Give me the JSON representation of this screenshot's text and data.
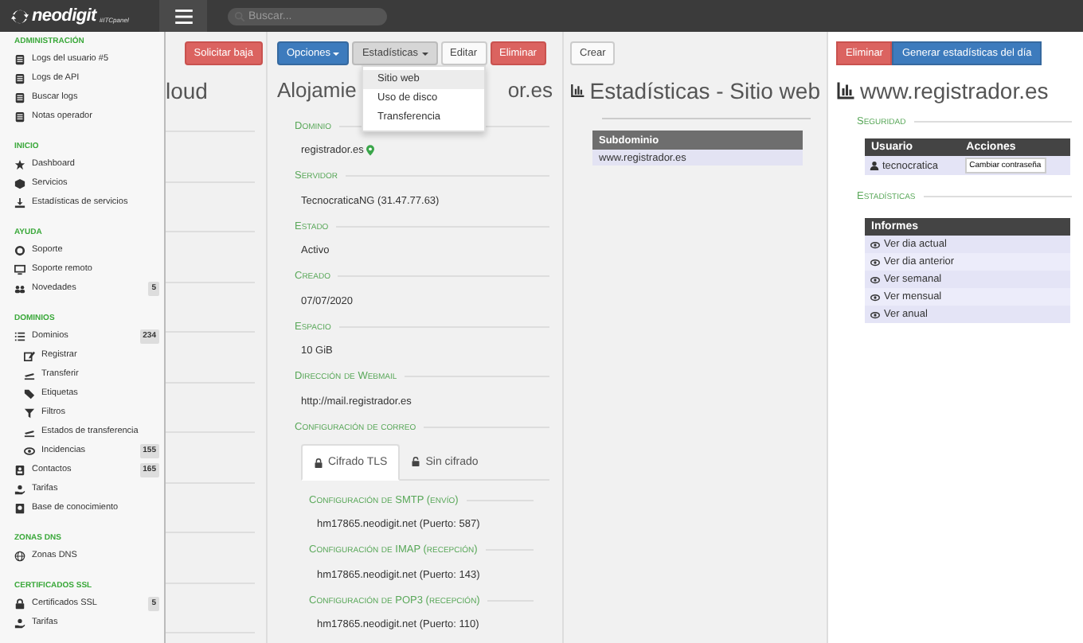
{
  "topbar": {
    "logo": "neodigit",
    "logo_tag": "#ITCpanel",
    "search": {
      "placeholder": "Buscar..."
    }
  },
  "sidebar": {
    "sections": [
      {
        "heading": "ADMINISTRACIÓN",
        "items": [
          {
            "label": "Logs del usuario #5"
          },
          {
            "label": "Logs de API"
          },
          {
            "label": "Buscar logs"
          },
          {
            "label": "Notas operador"
          }
        ]
      },
      {
        "heading": "INICIO",
        "items": [
          {
            "label": "Dashboard"
          },
          {
            "label": "Servicios"
          },
          {
            "label": "Estadísticas de servicios"
          }
        ]
      },
      {
        "heading": "AYUDA",
        "items": [
          {
            "label": "Soporte"
          },
          {
            "label": "Soporte remoto"
          },
          {
            "label": "Novedades",
            "badge": "5"
          }
        ]
      },
      {
        "heading": "DOMINIOS",
        "items": [
          {
            "label": "Dominios",
            "badge": "234",
            "children": [
              {
                "label": "Registrar"
              },
              {
                "label": "Transferir"
              },
              {
                "label": "Etiquetas"
              },
              {
                "label": "Filtros"
              },
              {
                "label": "Estados de transferencia"
              },
              {
                "label": "Incidencias",
                "badge": "155"
              }
            ]
          },
          {
            "label": "Contactos",
            "badge": "165"
          },
          {
            "label": "Tarifas"
          },
          {
            "label": "Base de conocimiento"
          }
        ]
      },
      {
        "heading": "ZONAS DNS",
        "items": [
          {
            "label": "Zonas DNS"
          }
        ]
      },
      {
        "heading": "CERTIFICADOS SSL",
        "items": [
          {
            "label": "Certificados SSL",
            "badge": "5"
          },
          {
            "label": "Tarifas"
          }
        ]
      }
    ]
  },
  "service_panel": {
    "buttons": [
      {
        "label": "Solicitar baja",
        "kind": "danger"
      }
    ],
    "title": "loud"
  },
  "hosting_panel": {
    "buttons": [
      {
        "label": "Opciones",
        "kind": "primary",
        "caret": true
      },
      {
        "label": "Estadísticas",
        "kind": "active",
        "caret": true
      },
      {
        "label": "Editar",
        "kind": "default",
        "caret": false
      },
      {
        "label": "Eliminar",
        "kind": "danger",
        "caret": false
      }
    ],
    "menu": [
      {
        "label": "Sitio web",
        "selected": true
      },
      {
        "label": "Uso de disco",
        "selected": false
      },
      {
        "label": "Transferencia",
        "selected": false
      }
    ],
    "title_start": "Alojamie",
    "title_end": "or.es",
    "fields": [
      {
        "label": "Dominio",
        "value": "registrador.es",
        "pin": true
      },
      {
        "label": "Servidor",
        "value": "TecnocraticaNG (31.47.77.63)",
        "pin": false
      },
      {
        "label": "Estado",
        "value": "Activo",
        "pin": false
      },
      {
        "label": "Creado",
        "value": "07/07/2020",
        "pin": false
      },
      {
        "label": "Espacio",
        "value": "10 GiB",
        "pin": false
      },
      {
        "label": "Dirección de Webmail",
        "value": "http://mail.registrador.es",
        "pin": false
      }
    ],
    "mail": {
      "label": "Configuración de correo",
      "tabs": [
        {
          "label": "Cifrado TLS",
          "selected": true,
          "locked": true
        },
        {
          "label": "Sin cifrado",
          "selected": false,
          "locked": false
        }
      ],
      "servers": [
        {
          "label": "Configuración de SMTP (envío)",
          "value": "hm17865.neodigit.net (Puerto: 587)"
        },
        {
          "label": "Configuración de IMAP (recepción)",
          "value": "hm17865.neodigit.net (Puerto: 143)"
        },
        {
          "label": "Configuración de POP3 (recepción)",
          "value": "hm17865.neodigit.net (Puerto: 110)"
        }
      ]
    }
  },
  "stats_panel": {
    "buttons": [
      {
        "label": "Crear",
        "kind": "default"
      }
    ],
    "title": "Estadísticas - Sitio web",
    "table": {
      "columns": [
        "Subdominio"
      ],
      "rows": [
        [
          "www.registrador.es"
        ]
      ]
    }
  },
  "detail_panel": {
    "buttons": [
      {
        "label": "Eliminar",
        "kind": "danger"
      },
      {
        "label": "Generar estadísticas del día",
        "kind": "primary"
      }
    ],
    "title": "www.registrador.es",
    "security": {
      "label": "Seguridad",
      "columns": [
        "Usuario",
        "Acciones"
      ],
      "rows": [
        {
          "user": "tecnocratica",
          "action": "Cambiar contraseña"
        }
      ]
    },
    "stats": {
      "label": "Estadísticas",
      "column": "Informes",
      "rows": [
        "Ver dia actual",
        "Ver dia anterior",
        "Ver semanal",
        "Ver mensual",
        "Ver anual"
      ]
    }
  }
}
